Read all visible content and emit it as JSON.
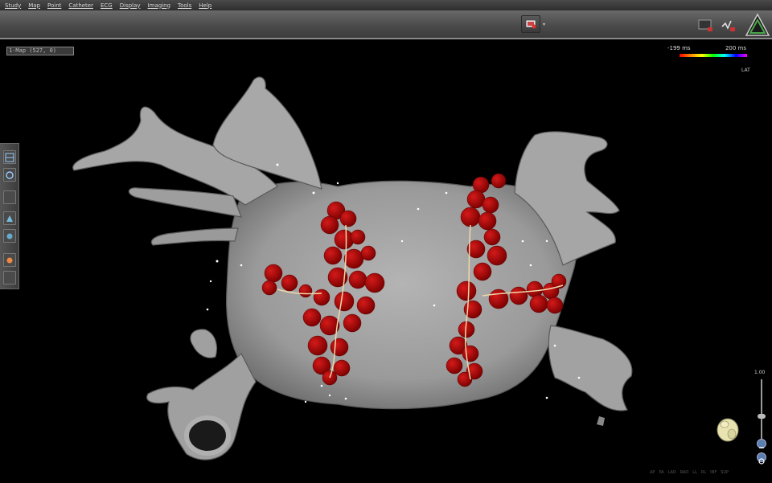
{
  "menu": {
    "items": [
      "Study",
      "Map",
      "Point",
      "Catheter",
      "ECG",
      "Display",
      "Imaging",
      "Tools",
      "Help"
    ]
  },
  "map_label": "1-Map (527, 0)",
  "colorbar": {
    "min_label": "-199 ms",
    "max_label": "200 ms",
    "unit_label": "LAT"
  },
  "zoom": {
    "value_label": "1.00",
    "level": 0.4
  },
  "view_labels": [
    "AP",
    "PA",
    "LAO",
    "RAO",
    "LL",
    "RL",
    "INF",
    "SUP"
  ],
  "colors": {
    "anatomy": "#9a9a9a",
    "ablation": "#a00000",
    "lesion_line": "#f0d8a8",
    "accent": "#4aa84a"
  },
  "icons": {
    "toolbar": [
      "snapshot-icon",
      "monitor-icon",
      "signal-icon",
      "logo-icon"
    ],
    "side": [
      "layout-icon",
      "rotate-icon",
      "blank-icon",
      "map-icon",
      "catheter-icon",
      "point-icon",
      "blank-icon"
    ]
  }
}
